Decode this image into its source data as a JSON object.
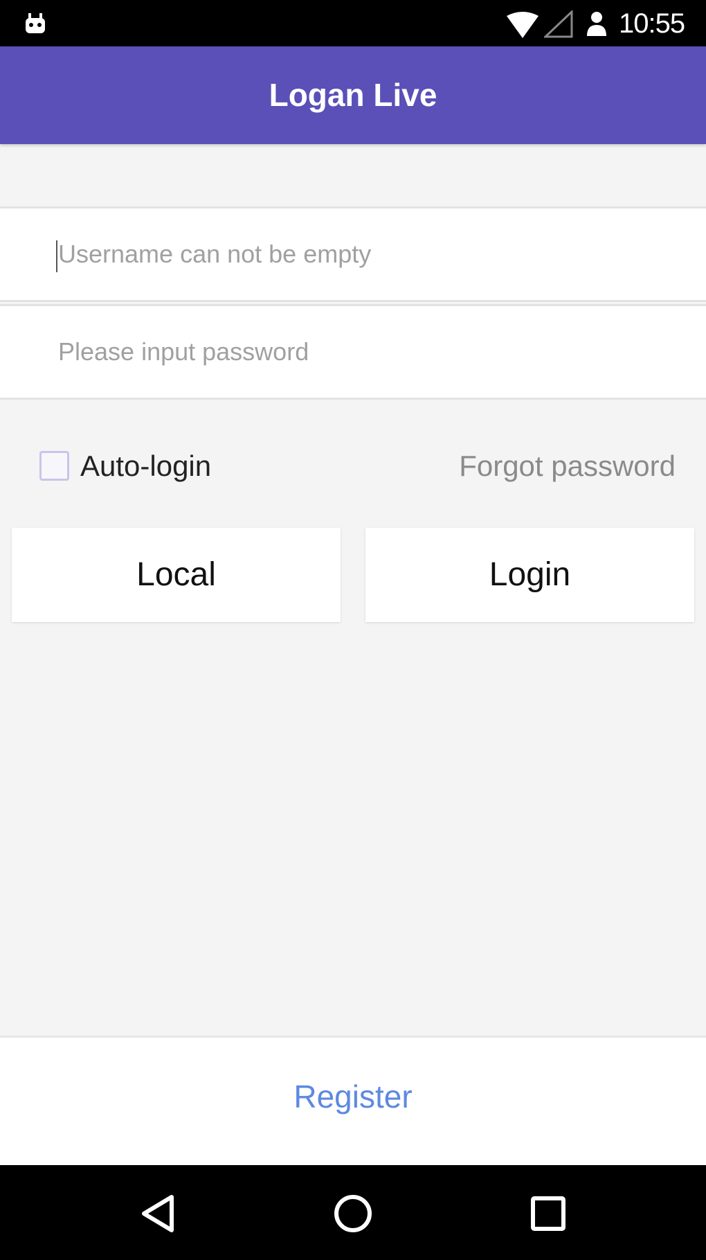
{
  "status_bar": {
    "time": "10:55",
    "left_icon": "android-notification-icon",
    "wifi_icon": "wifi-icon",
    "signal_icon": "signal-icon",
    "account_icon": "account-icon"
  },
  "app_bar": {
    "title": "Logan Live",
    "color": "#5a50b8"
  },
  "form": {
    "username": {
      "value": "",
      "placeholder": "Username can not be empty"
    },
    "password": {
      "value": "",
      "placeholder": "Please input password"
    },
    "auto_login": {
      "label": "Auto-login",
      "checked": false
    },
    "forgot_password_label": "Forgot password",
    "local_button_label": "Local",
    "login_button_label": "Login"
  },
  "register": {
    "label": "Register",
    "color": "#5d8ae0"
  },
  "nav_bar": {
    "back_icon": "back-icon",
    "home_icon": "home-icon",
    "recents_icon": "recents-icon"
  }
}
